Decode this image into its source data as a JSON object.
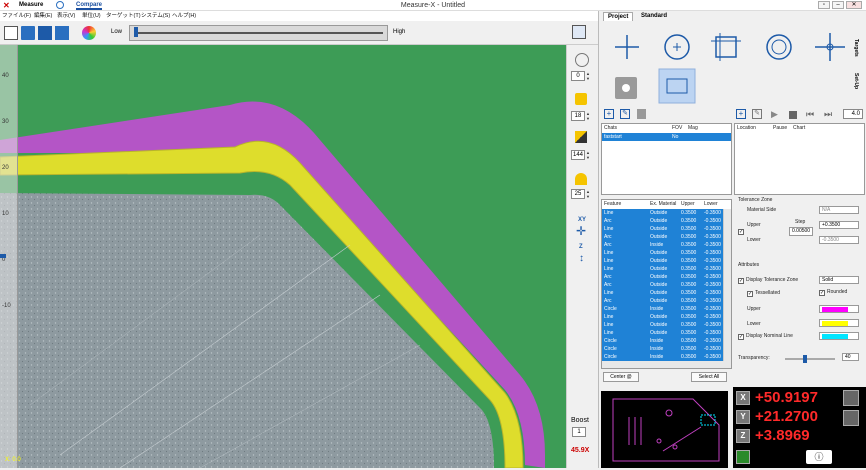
{
  "app": {
    "tabs": [
      "Measure",
      "Compare"
    ],
    "active_tab": "Compare",
    "title": "Measure-X - Untitled"
  },
  "menu": [
    "ファイル(F)",
    "編集(E)",
    "表示(V)",
    "単位(U)",
    "ターゲット(T)",
    "システム(S)",
    "ヘルプ(H)"
  ],
  "toolbar": {
    "low_label": "Low",
    "high_label": "High"
  },
  "viewport": {
    "ruler_labels": [
      "40",
      "30",
      "20",
      "10",
      "0",
      "-10"
    ],
    "status_left": "X: 0.0",
    "magnification": "45.9X",
    "boost_label": "Boost",
    "boost_value": "1"
  },
  "sidecol": {
    "values": [
      "0",
      "18",
      "144",
      "25"
    ],
    "xy_label": "XY",
    "z_label": "Z"
  },
  "right_tabs": [
    "Project",
    "Standard"
  ],
  "targets_label": "Targets",
  "setup_label": "Set-Up",
  "step_value": "4.0",
  "charts_table": {
    "headers": [
      "Chats",
      "FOV",
      "Mag"
    ],
    "rows": [
      {
        "name": "faststart",
        "fov": "No",
        "mag": ""
      }
    ]
  },
  "location_table": {
    "headers": [
      "Location",
      "Pause",
      "Chart"
    ]
  },
  "feature_table": {
    "headers": [
      "Feature",
      "Ex. Material",
      "Upper",
      "Lower"
    ],
    "rows": [
      [
        "Line",
        "Outside",
        "0.3500",
        "-0.3500"
      ],
      [
        "Arc",
        "Outside",
        "0.3500",
        "-0.3500"
      ],
      [
        "Line",
        "Outside",
        "0.3500",
        "-0.3500"
      ],
      [
        "Arc",
        "Outside",
        "0.3500",
        "-0.3500"
      ],
      [
        "Arc",
        "Inside",
        "0.3500",
        "-0.3500"
      ],
      [
        "Line",
        "Outside",
        "0.3500",
        "-0.3500"
      ],
      [
        "Line",
        "Outside",
        "0.3500",
        "-0.3500"
      ],
      [
        "Line",
        "Outside",
        "0.3500",
        "-0.3500"
      ],
      [
        "Arc",
        "Outside",
        "0.3500",
        "-0.3500"
      ],
      [
        "Arc",
        "Outside",
        "0.3500",
        "-0.3500"
      ],
      [
        "Line",
        "Outside",
        "0.3500",
        "-0.3500"
      ],
      [
        "Arc",
        "Outside",
        "0.3500",
        "-0.3500"
      ],
      [
        "Circle",
        "Inside",
        "0.3500",
        "-0.3500"
      ],
      [
        "Line",
        "Outside",
        "0.3500",
        "-0.3500"
      ],
      [
        "Line",
        "Outside",
        "0.3500",
        "-0.3500"
      ],
      [
        "Line",
        "Outside",
        "0.3500",
        "-0.3500"
      ],
      [
        "Circle",
        "Inside",
        "0.3500",
        "-0.3500"
      ],
      [
        "Circle",
        "Inside",
        "0.3500",
        "-0.3500"
      ],
      [
        "Circle",
        "Inside",
        "0.3500",
        "-0.3500"
      ]
    ],
    "center_button": "Center @",
    "select_all_button": "Select All"
  },
  "tolerance": {
    "title": "Tolerance Zone",
    "material_side": "Material Side",
    "material_value": "N/A",
    "upper_label": "Upper",
    "lower_label": "Lower",
    "step_label": "Step",
    "step_value": "0.00500",
    "upper_value": "+0.3500",
    "lower_value": "-0.3500"
  },
  "attributes": {
    "title": "Attributes",
    "display_zone": "Display Tolerance Zone",
    "zone_style": "Solid",
    "tessellated": "Tessellated",
    "rounded": "Rounded",
    "upper_label": "Upper",
    "lower_label": "Lower",
    "display_nominal": "Display Nominal Line",
    "transparency_label": "Transparency:",
    "transparency_value": "40",
    "upper_color": "#ff00ff",
    "lower_color": "#ffff00",
    "nominal_color": "#00e5ff"
  },
  "dro": {
    "x_label": "X",
    "y_label": "Y",
    "z_label": "Z",
    "x": "+50.9197",
    "y": "+21.2700",
    "z": "+3.8969"
  },
  "colors": {
    "accent": "#1f82d6",
    "dro_red": "#ff2a2a",
    "zone_purple": "#b050c0",
    "zone_yellow": "#e8ea2a"
  }
}
